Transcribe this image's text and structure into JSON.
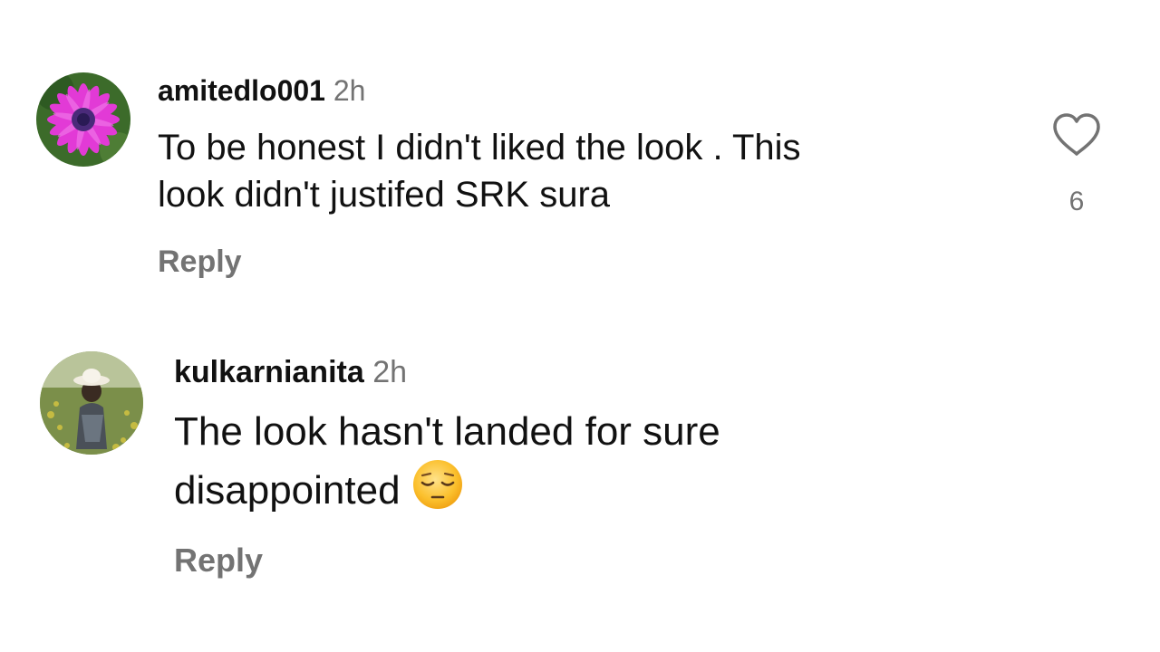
{
  "comments": [
    {
      "username": "amitedlo001",
      "time": "2h",
      "lines": [
        "To be honest I didn't liked the look . This",
        "look didn't justifed SRK sura"
      ],
      "reply_label": "Reply",
      "like_count": "6",
      "avatar_icon": "purple-flower-avatar"
    },
    {
      "username": "kulkarnianita",
      "time": "2h",
      "lines": [
        "The look hasn't landed for sure",
        "disappointed"
      ],
      "emoji": "pensive-face-emoji",
      "reply_label": "Reply",
      "avatar_icon": "person-in-field-avatar"
    }
  ],
  "colors": {
    "text": "#111111",
    "muted": "#737373",
    "background": "#ffffff"
  }
}
